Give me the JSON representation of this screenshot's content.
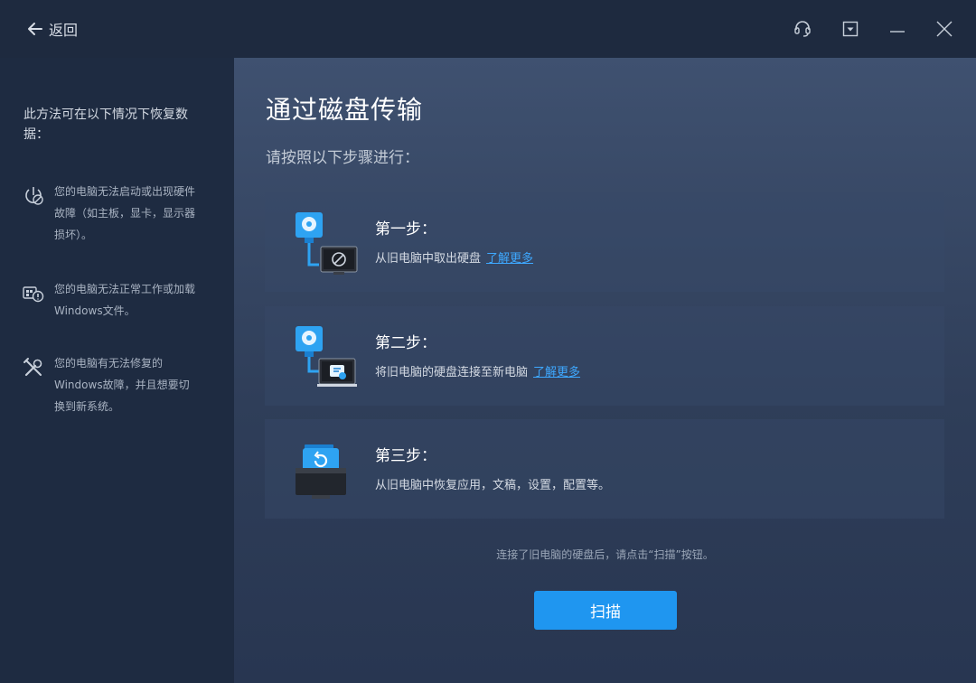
{
  "titlebar": {
    "back_label": "返回",
    "icons": [
      "headset-icon",
      "minimize-to-tray-icon",
      "minimize-icon",
      "close-icon"
    ]
  },
  "sidebar": {
    "heading": "此方法可在以下情况下恢复数据：",
    "reasons": [
      {
        "icon": "power-disabled-icon",
        "text": "您的电脑无法启动或出现硬件故障（如主板，显卡，显示器损坏）。"
      },
      {
        "icon": "windows-error-icon",
        "text": "您的电脑无法正常工作或加载Windows文件。"
      },
      {
        "icon": "tools-icon",
        "text": "您的电脑有无法修复的Windows故障，并且想要切换到新系统。"
      }
    ]
  },
  "main": {
    "title": "通过磁盘传输",
    "subtitle": "请按照以下步骤进行：",
    "steps": [
      {
        "name": "第一步：",
        "desc": "从旧电脑中取出硬盘",
        "link": "了解更多",
        "icon": "disk-remove-icon"
      },
      {
        "name": "第二步：",
        "desc": "将旧电脑的硬盘连接至新电脑",
        "link": "了解更多",
        "icon": "disk-connect-icon"
      },
      {
        "name": "第三步：",
        "desc": "从旧电脑中恢复应用，文稿，设置，配置等。",
        "icon": "restore-folder-icon"
      }
    ],
    "hint": "连接了旧电脑的硬盘后，请点击“扫描”按钮。",
    "scan_label": "扫描"
  },
  "colors": {
    "accent": "#1f96f0",
    "link": "#3ea8ff",
    "sidebar_bg": "#1e2b41",
    "titlebar_bg": "#1e2a3f"
  }
}
